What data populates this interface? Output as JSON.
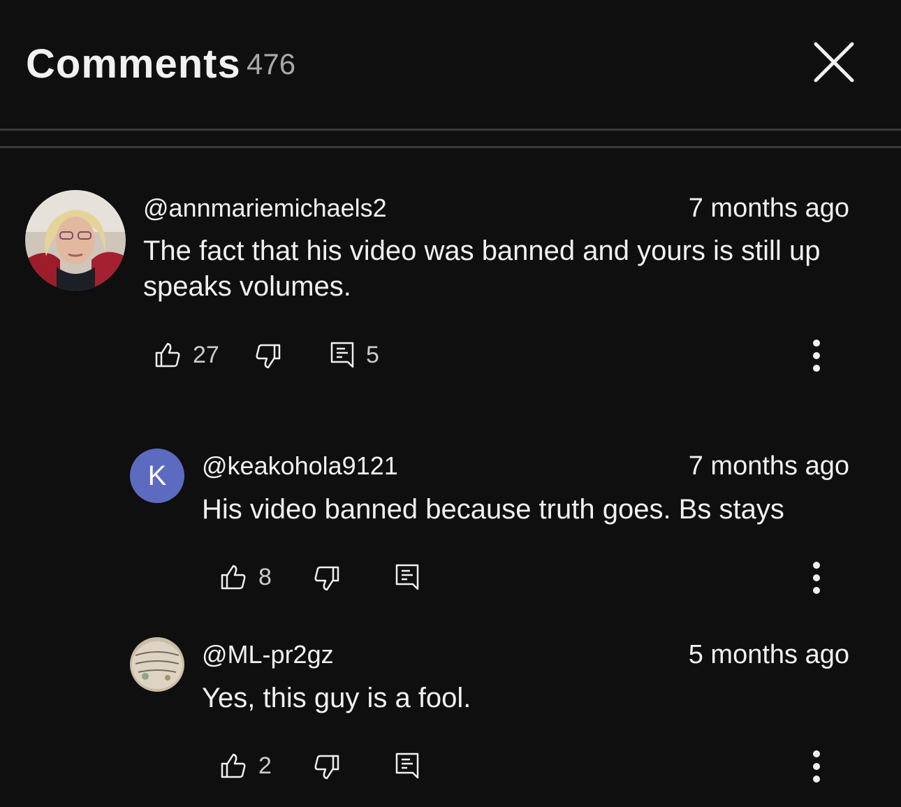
{
  "header": {
    "title": "Comments",
    "count": "476"
  },
  "comments": [
    {
      "handle": "@annmariemichaels2",
      "time": "7 months ago",
      "text": "The fact that his video was banned and yours is still up speaks volumes.",
      "likes": "27",
      "replies": "5"
    },
    {
      "handle": "@keakohola9121",
      "avatar_letter": "K",
      "avatar_color": "#5c6bc0",
      "time": "7 months ago",
      "text": "His video banned because truth goes. Bs stays",
      "likes": "8"
    },
    {
      "handle": "@ML-pr2gz",
      "time": "5 months ago",
      "text": "Yes, this guy is a fool.",
      "likes": "2"
    }
  ],
  "icons": {
    "close": "close-icon",
    "like": "thumbs-up-icon",
    "dislike": "thumbs-down-icon",
    "reply": "reply-icon",
    "more": "more-vertical-icon"
  },
  "colors": {
    "background": "#0f0f0f",
    "text": "#f1f1f1",
    "muted": "#aaaaaa"
  }
}
